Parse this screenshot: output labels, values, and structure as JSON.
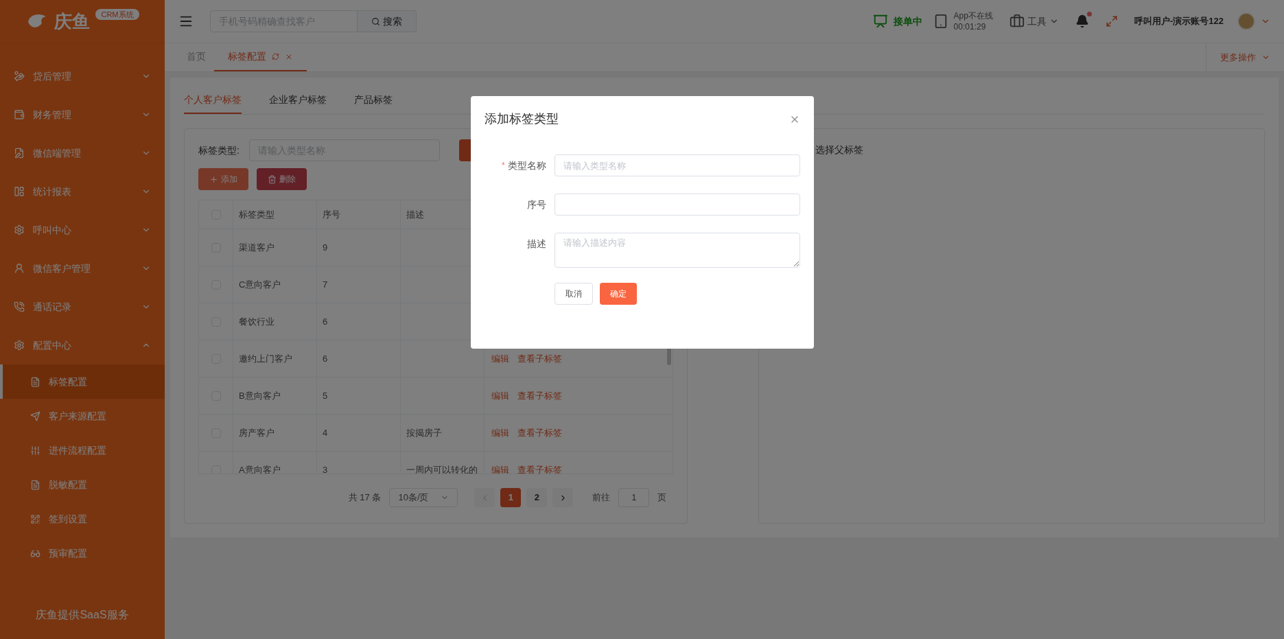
{
  "sidebar": {
    "logo": {
      "name": "庆鱼",
      "badge": "CRM系统"
    },
    "items": [
      {
        "label": "贷后管理",
        "expanded": false
      },
      {
        "label": "财务管理",
        "expanded": false
      },
      {
        "label": "微信端管理",
        "expanded": false
      },
      {
        "label": "统计报表",
        "expanded": false
      },
      {
        "label": "呼叫中心",
        "expanded": false
      },
      {
        "label": "微信客户管理",
        "expanded": false
      },
      {
        "label": "通话记录",
        "expanded": false
      },
      {
        "label": "配置中心",
        "expanded": true,
        "children": [
          {
            "label": "标签配置",
            "selected": true
          },
          {
            "label": "客户来源配置",
            "selected": false
          },
          {
            "label": "进件流程配置",
            "selected": false
          },
          {
            "label": "脱敏配置",
            "selected": false
          },
          {
            "label": "签到设置",
            "selected": false
          },
          {
            "label": "预审配置",
            "selected": false
          }
        ]
      }
    ],
    "footer": "庆鱼提供SaaS服务"
  },
  "topbar": {
    "search": {
      "placeholder": "手机号码精确查找客户",
      "button": "搜索"
    },
    "order_status": "接单中",
    "app_status": {
      "label": "App不在线",
      "timer": "00:01:29"
    },
    "tools": "工具",
    "notifications": {
      "unread": true
    },
    "user": "呼叫用户-演示账号122"
  },
  "page_tabs": [
    {
      "label": "首页",
      "selected": false,
      "closable": false
    },
    {
      "label": "标签配置",
      "selected": true,
      "closable": true
    }
  ],
  "more_actions": "更多操作",
  "content": {
    "tabs": [
      {
        "label": "个人客户标签",
        "selected": true
      },
      {
        "label": "企业客户标签",
        "selected": false
      },
      {
        "label": "产品标签",
        "selected": false
      }
    ],
    "filter": {
      "label": "标签类型:",
      "placeholder": "请输入类型名称"
    },
    "buttons": [
      {
        "label": "添加",
        "kind": "add"
      },
      {
        "label": "删除",
        "kind": "delete"
      }
    ],
    "table": {
      "columns": [
        "标签类型",
        "序号",
        "描述"
      ],
      "header_checked": false,
      "rows": [
        {
          "checked": false,
          "cells": [
            "渠道客户",
            "9",
            ""
          ]
        },
        {
          "checked": false,
          "cells": [
            "C意向客户",
            "7",
            ""
          ]
        },
        {
          "checked": false,
          "cells": [
            "餐饮行业",
            "6",
            ""
          ]
        },
        {
          "checked": false,
          "cells": [
            "邀约上门客户",
            "6",
            ""
          ],
          "actions": [
            "编辑",
            "查看子标签"
          ]
        },
        {
          "checked": false,
          "cells": [
            "B意向客户",
            "5",
            ""
          ],
          "actions": [
            "编辑",
            "查看子标签"
          ]
        },
        {
          "checked": false,
          "cells": [
            "房产客户",
            "4",
            "按揭房子"
          ],
          "actions": [
            "编辑",
            "查看子标签"
          ]
        },
        {
          "checked": false,
          "cells": [
            "A意向客户",
            "3",
            "一周内可以转化的"
          ],
          "actions": [
            "编辑",
            "查看子标签"
          ]
        }
      ]
    },
    "pagination": {
      "total": "共 17 条",
      "page_size": "10条/页",
      "pages": [
        {
          "label": "1",
          "selected": true
        },
        {
          "label": "2",
          "selected": false
        }
      ],
      "goto_label": "前往",
      "goto_value": "1",
      "goto_suffix": "页"
    },
    "right_panel": {
      "hint": "选择父标签"
    }
  },
  "dialog": {
    "title": "添加标签类型",
    "fields": [
      {
        "label": "类型名称",
        "required_mark": "*",
        "kind": "input",
        "placeholder": "请输入类型名称"
      },
      {
        "label": "序号",
        "kind": "input"
      },
      {
        "label": "描述",
        "kind": "textarea",
        "placeholder": "请输入描述内容"
      }
    ],
    "buttons": [
      {
        "label": "取消",
        "kind": "secondary"
      },
      {
        "label": "确定",
        "kind": "primary"
      }
    ]
  }
}
